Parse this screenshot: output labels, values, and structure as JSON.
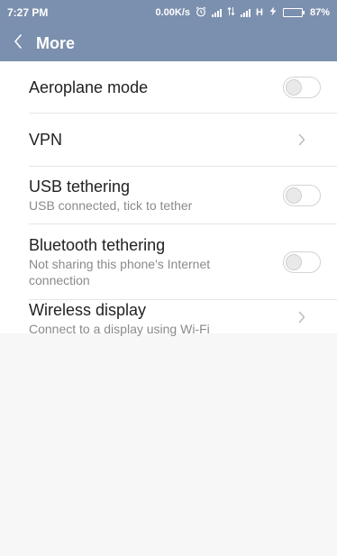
{
  "statusbar": {
    "time": "7:27 PM",
    "speed": "0.00K/s",
    "network_type": "H",
    "battery": "87%",
    "battery_level": 0.87,
    "battery_color": "#47d147"
  },
  "appbar": {
    "title": "More",
    "back_icon": "chevron-left-icon",
    "color": "#7b8fae"
  },
  "settings": [
    {
      "label": "Aeroplane mode",
      "subtitle": "",
      "control": "toggle",
      "on": false
    },
    {
      "label": "VPN",
      "subtitle": "",
      "control": "chevron"
    },
    {
      "label": "USB tethering",
      "subtitle": "USB connected, tick to tether",
      "control": "toggle",
      "on": false
    },
    {
      "label": "Bluetooth tethering",
      "subtitle": "Not sharing this phone's Internet connection",
      "control": "toggle",
      "on": false
    },
    {
      "label": "Wireless display",
      "subtitle": "Connect to a display using Wi-Fi",
      "control": "chevron"
    }
  ]
}
